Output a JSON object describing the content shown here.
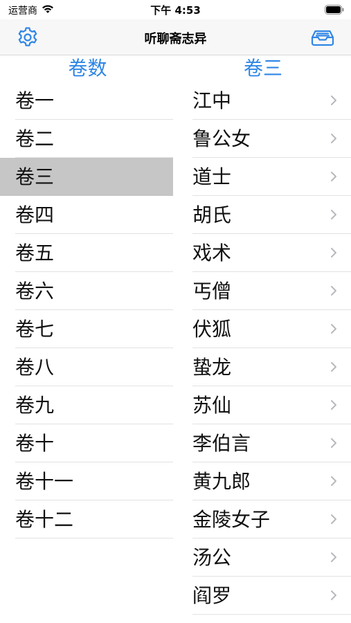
{
  "status_bar": {
    "carrier": "运营商",
    "time": "下午 4:53"
  },
  "nav": {
    "title": "听聊斋志异",
    "left_icon": "gear-icon",
    "right_icon": "inbox-tray-icon",
    "accent_color": "#2f86e6"
  },
  "volumes": {
    "header": "卷数",
    "selected": "卷三",
    "items": [
      {
        "label": "卷一"
      },
      {
        "label": "卷二"
      },
      {
        "label": "卷三"
      },
      {
        "label": "卷四"
      },
      {
        "label": "卷五"
      },
      {
        "label": "卷六"
      },
      {
        "label": "卷七"
      },
      {
        "label": "卷八"
      },
      {
        "label": "卷九"
      },
      {
        "label": "卷十"
      },
      {
        "label": "卷十一"
      },
      {
        "label": "卷十二"
      }
    ]
  },
  "stories": {
    "header": "卷三",
    "items": [
      {
        "label": "江中"
      },
      {
        "label": "鲁公女"
      },
      {
        "label": "道士"
      },
      {
        "label": "胡氏"
      },
      {
        "label": "戏术"
      },
      {
        "label": "丐僧"
      },
      {
        "label": "伏狐"
      },
      {
        "label": "蛰龙"
      },
      {
        "label": "苏仙"
      },
      {
        "label": "李伯言"
      },
      {
        "label": "黄九郎"
      },
      {
        "label": "金陵女子"
      },
      {
        "label": "汤公"
      },
      {
        "label": "阎罗"
      }
    ]
  }
}
